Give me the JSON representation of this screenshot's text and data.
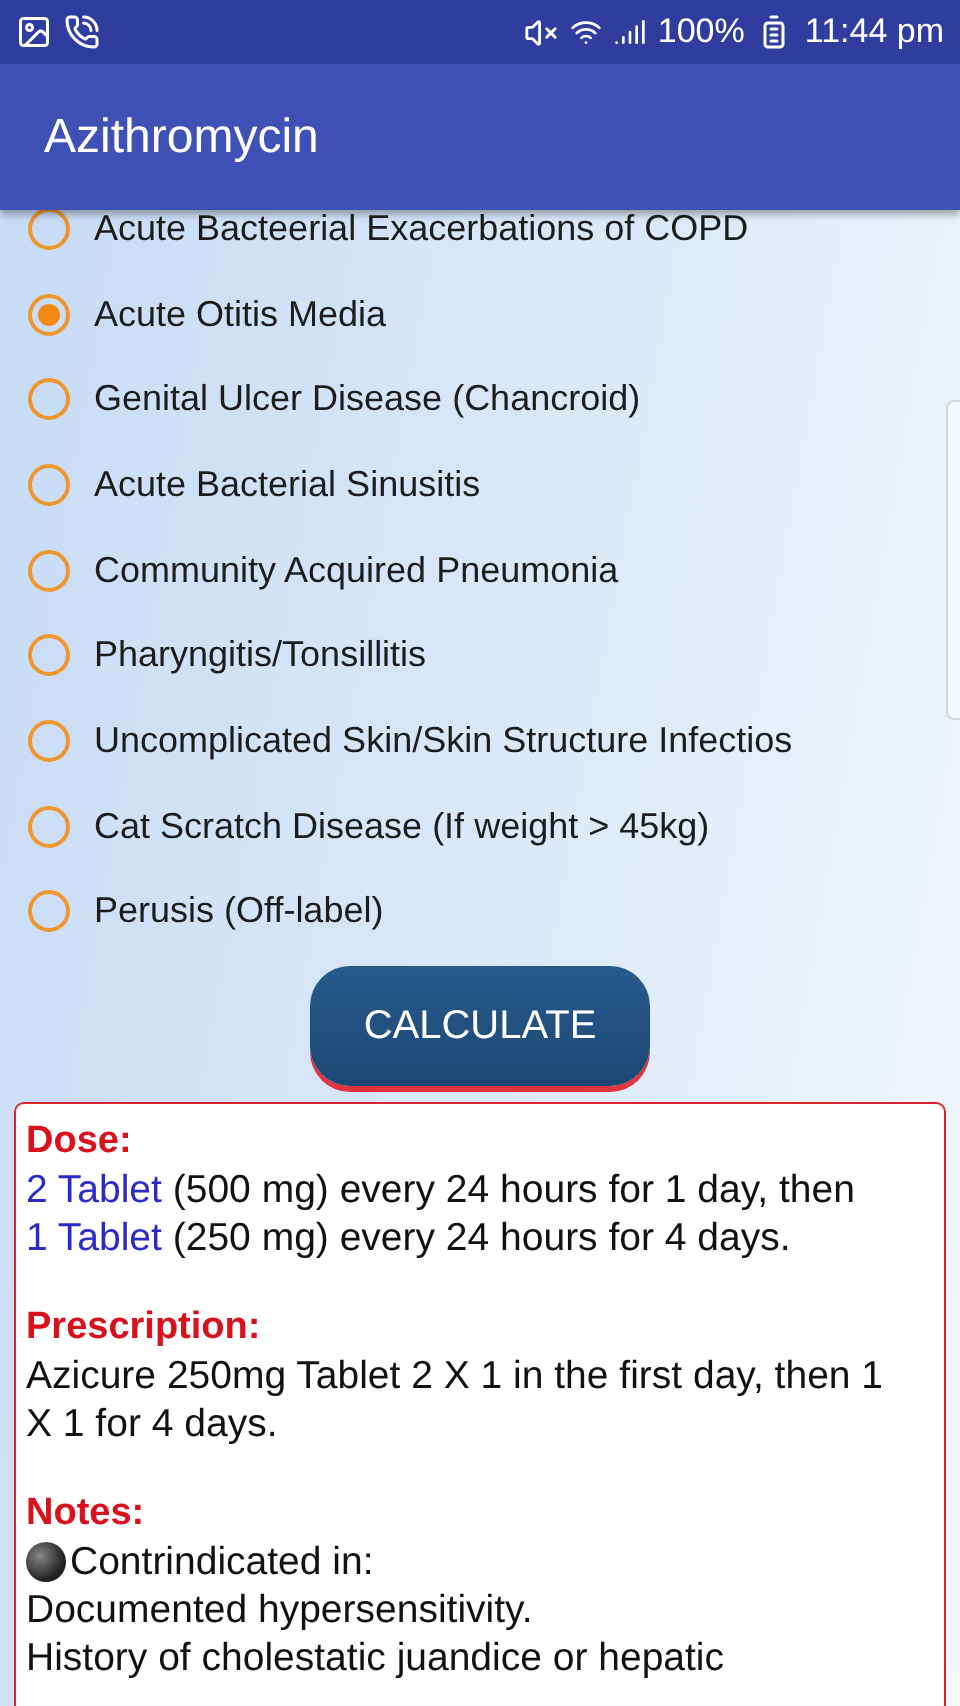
{
  "status_bar": {
    "battery": "100%",
    "time": "11:44 pm"
  },
  "app_bar": {
    "title": "Azithromycin"
  },
  "indications": [
    {
      "label": "Acute Bacteerial Exacerbations of COPD",
      "selected": false
    },
    {
      "label": "Acute Otitis Media",
      "selected": true
    },
    {
      "label": "Genital Ulcer Disease (Chancroid)",
      "selected": false
    },
    {
      "label": "Acute Bacterial Sinusitis",
      "selected": false
    },
    {
      "label": "Community Acquired Pneumonia",
      "selected": false
    },
    {
      "label": "Pharyngitis/Tonsillitis",
      "selected": false
    },
    {
      "label": "Uncomplicated Skin/Skin Structure Infectios",
      "selected": false
    },
    {
      "label": "Cat Scratch Disease (If weight > 45kg)",
      "selected": false
    },
    {
      "label": "Perusis (Off-label)",
      "selected": false
    }
  ],
  "calculate_button": "CALCULATE",
  "result": {
    "dose": {
      "heading": "Dose:",
      "lines": [
        {
          "amount": "2 Tablet",
          "text": "(500 mg) every 24 hours for 1 day, then"
        },
        {
          "amount": "1 Tablet",
          "text": "(250 mg) every 24 hours for 4 days."
        }
      ]
    },
    "prescription": {
      "heading": "Prescription:",
      "text": "Azicure 250mg Tablet 2 X 1 in the first day, then 1 X 1 for 4 days."
    },
    "notes": {
      "heading": "Notes:",
      "bullet": "Contrindicated in:",
      "lines": [
        "Documented hypersensitivity.",
        "History of cholestatic juandice or hepatic"
      ]
    }
  }
}
